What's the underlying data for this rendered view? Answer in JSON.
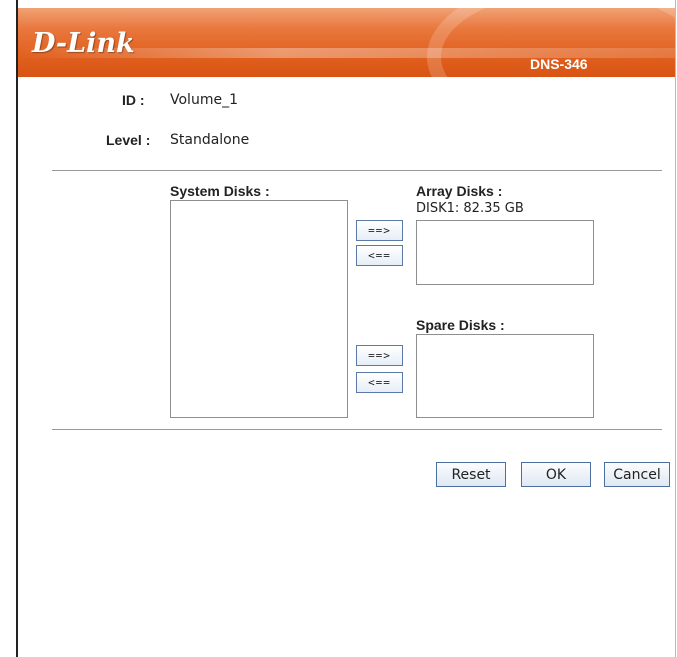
{
  "header": {
    "brand": "D-Link",
    "model": "DNS-346"
  },
  "fields": {
    "id_label": "ID :",
    "id_value": "Volume_1",
    "level_label": "Level :",
    "level_value": "Standalone"
  },
  "disks": {
    "system_label": "System Disks :",
    "array_label": "Array Disks :",
    "array_items": [
      "DISK1: 82.35 GB"
    ],
    "spare_label": "Spare Disks :",
    "move_right": "==>",
    "move_left": "<=="
  },
  "actions": {
    "reset": "Reset",
    "ok": "OK",
    "cancel": "Cancel"
  },
  "colors": {
    "header_orange": "#e1601e",
    "button_border": "#4d6f9f"
  }
}
